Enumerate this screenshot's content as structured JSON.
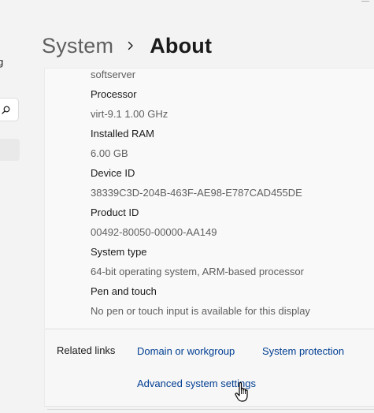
{
  "breadcrumb": {
    "parent": "System",
    "current": "About"
  },
  "sidebar": {
    "partial_label": "g"
  },
  "specs": [
    {
      "value": "softserver"
    },
    {
      "label": "Processor",
      "value": "virt-9.1   1.00 GHz"
    },
    {
      "label": "Installed RAM",
      "value": "6.00 GB"
    },
    {
      "label": "Device ID",
      "value": "38339C3D-204B-463F-AE98-E787CAD455DE"
    },
    {
      "label": "Product ID",
      "value": "00492-80050-00000-AA149"
    },
    {
      "label": "System type",
      "value": "64-bit operating system, ARM-based processor"
    },
    {
      "label": "Pen and touch",
      "value": "No pen or touch input is available for this display"
    }
  ],
  "related_links": {
    "title": "Related links",
    "links": [
      "Domain or workgroup",
      "System protection",
      "Advanced system settings"
    ]
  },
  "icons": {
    "search": "search-icon",
    "chevron": "chevron-right-icon",
    "cursor": "hand-pointer-cursor-icon"
  },
  "colors": {
    "link": "#003e92",
    "background": "#f3f3f3",
    "card": "#f9f9f9"
  }
}
